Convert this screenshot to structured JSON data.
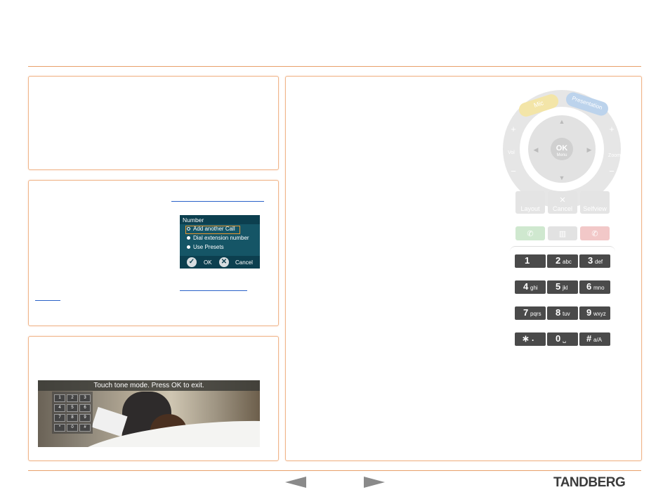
{
  "dialog": {
    "title": "Number",
    "options": [
      "Add another Call",
      "Dial extension number",
      "Use Presets"
    ],
    "ok_label": "OK",
    "cancel_label": "Cancel"
  },
  "touch_tone": {
    "banner": "Touch tone mode. Press OK to exit.",
    "keys": [
      "1",
      "2",
      "3",
      "4",
      "5",
      "6",
      "7",
      "8",
      "9",
      "*",
      "0",
      "#"
    ]
  },
  "remote": {
    "mic_label": "Mic",
    "presentation_label": "Presentation",
    "volume_label": "Vol",
    "zoom_label": "Zoom",
    "ok_label": "OK",
    "menu_label": "Menu",
    "layout_label": "Layout",
    "cancel_label": "Cancel",
    "selfview_label": "Selfview",
    "keypad": [
      {
        "digit": "1",
        "letters": ""
      },
      {
        "digit": "2",
        "letters": "abc"
      },
      {
        "digit": "3",
        "letters": "def"
      },
      {
        "digit": "4",
        "letters": "ghi"
      },
      {
        "digit": "5",
        "letters": "jkl"
      },
      {
        "digit": "6",
        "letters": "mno"
      },
      {
        "digit": "7",
        "letters": "pqrs"
      },
      {
        "digit": "8",
        "letters": "tuv"
      },
      {
        "digit": "9",
        "letters": "wxyz"
      },
      {
        "digit": "∗",
        "letters": "."
      },
      {
        "digit": "0",
        "letters": "␣"
      },
      {
        "digit": "#",
        "letters": "a/A"
      }
    ]
  },
  "footer": {
    "logo": "TANDBERG",
    "prev_icon": "arrow-left-icon",
    "next_icon": "arrow-right-icon"
  },
  "colors": {
    "accent": "#e8a06a",
    "link": "#2a62c8",
    "dialog_bg": "#0c3f4f",
    "key_bg": "#4a4a4a"
  }
}
